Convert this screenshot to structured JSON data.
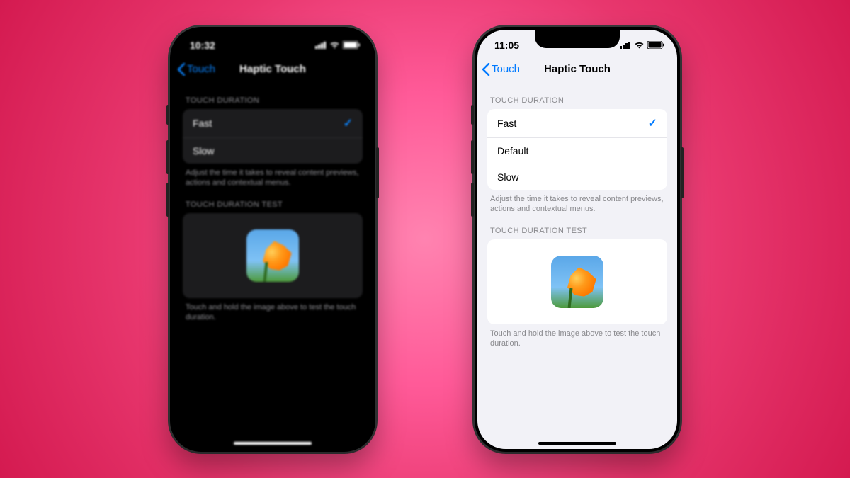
{
  "left": {
    "statusbar": {
      "time": "10:32"
    },
    "nav": {
      "back_label": "Touch",
      "title": "Haptic Touch"
    },
    "section1_header": "TOUCH DURATION",
    "options": [
      {
        "label": "Fast",
        "selected": true
      },
      {
        "label": "Slow",
        "selected": false
      }
    ],
    "section1_footer": "Adjust the time it takes to reveal content previews, actions and contextual menus.",
    "section2_header": "TOUCH DURATION TEST",
    "section2_footer": "Touch and hold the image above to test the touch duration.",
    "theme": "dark"
  },
  "right": {
    "statusbar": {
      "time": "11:05"
    },
    "nav": {
      "back_label": "Touch",
      "title": "Haptic Touch"
    },
    "section1_header": "TOUCH DURATION",
    "options": [
      {
        "label": "Fast",
        "selected": true
      },
      {
        "label": "Default",
        "selected": false
      },
      {
        "label": "Slow",
        "selected": false
      }
    ],
    "section1_footer": "Adjust the time it takes to reveal content previews, actions and contextual menus.",
    "section2_header": "TOUCH DURATION TEST",
    "section2_footer": "Touch and hold the image above to test the touch duration.",
    "theme": "light"
  },
  "colors": {
    "accent_dark": "#0a84ff",
    "accent_light": "#007aff"
  }
}
